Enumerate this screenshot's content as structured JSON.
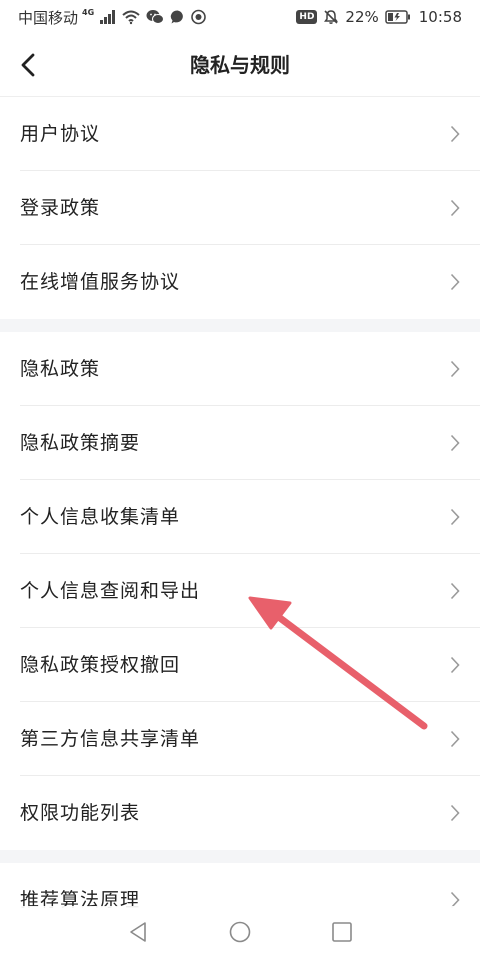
{
  "status_bar": {
    "carrier": "中国移动",
    "network": "4G",
    "hd": "HD",
    "battery": "22%",
    "time": "10:58"
  },
  "header": {
    "title": "隐私与规则"
  },
  "groups": [
    {
      "items": [
        {
          "label": "用户协议"
        },
        {
          "label": "登录政策"
        },
        {
          "label": "在线增值服务协议"
        }
      ]
    },
    {
      "items": [
        {
          "label": "隐私政策"
        },
        {
          "label": "隐私政策摘要"
        },
        {
          "label": "个人信息收集清单"
        },
        {
          "label": "个人信息查阅和导出"
        },
        {
          "label": "隐私政策授权撤回"
        },
        {
          "label": "第三方信息共享清单"
        },
        {
          "label": "权限功能列表"
        }
      ]
    },
    {
      "items": [
        {
          "label": "推荐算法原理"
        }
      ]
    }
  ],
  "colors": {
    "accent_arrow": "#e8606b",
    "section_gap": "#f4f5f7",
    "divider": "#ececec",
    "chevron": "#9a9a9a"
  },
  "icons": {
    "back": "chevron-left-icon",
    "row": "chevron-right-icon",
    "sys_back": "triangle-back-icon",
    "sys_home": "circle-home-icon",
    "sys_recent": "square-recent-icon"
  }
}
